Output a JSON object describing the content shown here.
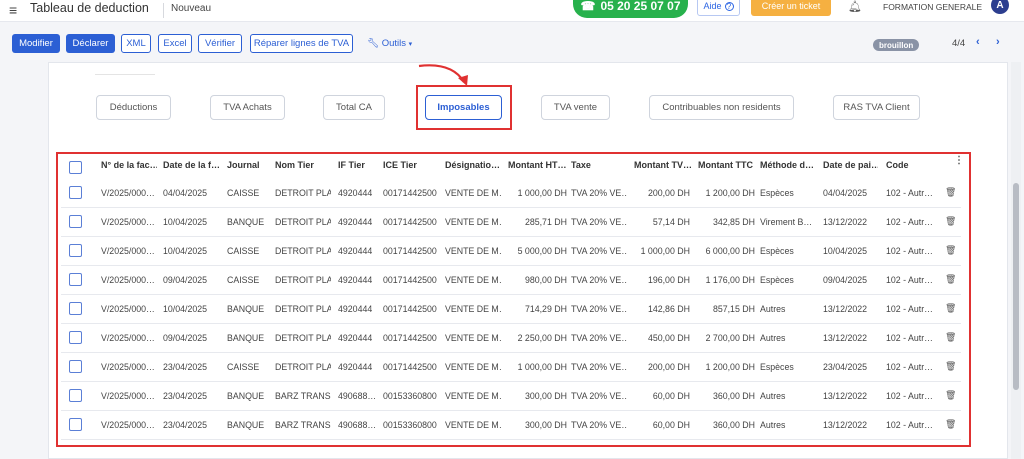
{
  "header": {
    "menu_icon": "hamburger-icon",
    "title": "Tableau de deduction",
    "subtitle": "Nouveau",
    "phone": "05 20 25 07 07",
    "help_label": "Aide",
    "ticket_label": "Créer un ticket",
    "organization": "FORMATION GENERALE",
    "avatar_letter": "A"
  },
  "toolbar": {
    "buttons": [
      "Modifier",
      "Déclarer",
      "XML",
      "Excel",
      "Vérifier",
      "Réparer lignes de TVA"
    ],
    "tools_label": "Outils",
    "status_badge": "brouillon",
    "pagination": "4/4"
  },
  "tabs": [
    "Déductions",
    "TVA Achats",
    "Total CA",
    "Imposables",
    "TVA vente",
    "Contribuables non residents",
    "RAS TVA Client"
  ],
  "active_tab": "Imposables",
  "table": {
    "columns": [
      "N° de la fac…",
      "Date de la f…",
      "Journal",
      "Nom Tier",
      "IF Tier",
      "ICE Tier",
      "Désignatio…",
      "Montant HT…",
      "Taxe",
      "Montant TV…",
      "Montant TTC",
      "Méthode d…",
      "Date de pai…",
      "Code"
    ],
    "rows": [
      [
        "V/2025/000…",
        "04/04/2025",
        "CAISSE",
        "DETROIT PLA…",
        "4920444",
        "00171442500…",
        "VENTE DE M…",
        "1 000,00 DH",
        "TVA 20% VE…",
        "200,00 DH",
        "1 200,00 DH",
        "Espèces",
        "04/04/2025",
        "102 - Autr…"
      ],
      [
        "V/2025/000…",
        "10/04/2025",
        "BANQUE",
        "DETROIT PLA…",
        "4920444",
        "00171442500…",
        "VENTE DE M…",
        "285,71 DH",
        "TVA 20% VE…",
        "57,14 DH",
        "342,85 DH",
        "Virement B…",
        "13/12/2022",
        "102 - Autr…"
      ],
      [
        "V/2025/000…",
        "10/04/2025",
        "CAISSE",
        "DETROIT PLA…",
        "4920444",
        "00171442500…",
        "VENTE DE M…",
        "5 000,00 DH",
        "TVA 20% VE…",
        "1 000,00 DH",
        "6 000,00 DH",
        "Espèces",
        "10/04/2025",
        "102 - Autr…"
      ],
      [
        "V/2025/000…",
        "09/04/2025",
        "CAISSE",
        "DETROIT PLA…",
        "4920444",
        "00171442500…",
        "VENTE DE M…",
        "980,00 DH",
        "TVA 20% VE…",
        "196,00 DH",
        "1 176,00 DH",
        "Espèces",
        "09/04/2025",
        "102 - Autr…"
      ],
      [
        "V/2025/000…",
        "10/04/2025",
        "BANQUE",
        "DETROIT PLA…",
        "4920444",
        "00171442500…",
        "VENTE DE M…",
        "714,29 DH",
        "TVA 20% VE…",
        "142,86 DH",
        "857,15 DH",
        "Autres",
        "13/12/2022",
        "102 - Autr…"
      ],
      [
        "V/2025/000…",
        "09/04/2025",
        "BANQUE",
        "DETROIT PLA…",
        "4920444",
        "00171442500…",
        "VENTE DE M…",
        "2 250,00 DH",
        "TVA 20% VE…",
        "450,00 DH",
        "2 700,00 DH",
        "Autres",
        "13/12/2022",
        "102 - Autr…"
      ],
      [
        "V/2025/000…",
        "23/04/2025",
        "CAISSE",
        "DETROIT PLA…",
        "4920444",
        "00171442500…",
        "VENTE DE M…",
        "1 000,00 DH",
        "TVA 20% VE…",
        "200,00 DH",
        "1 200,00 DH",
        "Espèces",
        "23/04/2025",
        "102 - Autr…"
      ],
      [
        "V/2025/000…",
        "23/04/2025",
        "BANQUE",
        "BARZ TRANS…",
        "490688…",
        "00153360800…",
        "VENTE DE M…",
        "300,00 DH",
        "TVA 20% VE…",
        "60,00 DH",
        "360,00 DH",
        "Autres",
        "13/12/2022",
        "102 - Autr…"
      ],
      [
        "V/2025/000…",
        "23/04/2025",
        "BANQUE",
        "BARZ TRANS…",
        "490688…",
        "00153360800…",
        "VENTE DE M…",
        "300,00 DH",
        "TVA 20% VE…",
        "60,00 DH",
        "360,00 DH",
        "Autres",
        "13/12/2022",
        "102 - Autr…"
      ]
    ]
  },
  "icons": {
    "phone": "headset-icon",
    "help": "question-icon",
    "bell": "bell-icon",
    "tools": "wrench-icon",
    "row_delete": "trash-icon",
    "column_menu": "kebab-icon"
  },
  "colors": {
    "primary": "#2c5fd4",
    "phone_green": "#27b14c",
    "ticket_orange": "#f5b041",
    "highlight_red": "#e03131"
  }
}
